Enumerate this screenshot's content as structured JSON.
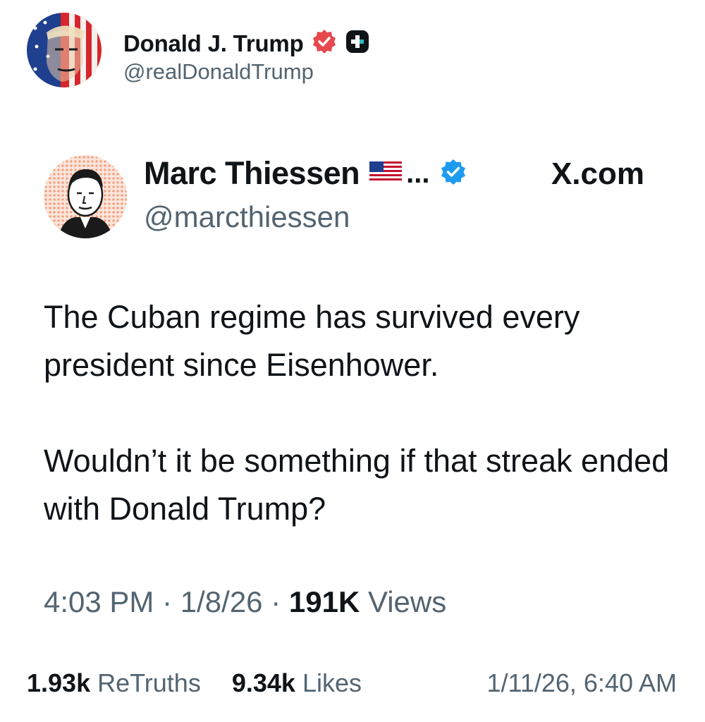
{
  "truth": {
    "author_name": "Donald J. Trump",
    "author_handle": "@realDonaldTrump",
    "verified_badge_color": "#e5484d"
  },
  "embed": {
    "author_name": "Marc Thiessen",
    "name_ellipsis": "...",
    "author_handle": "@marcthiessen",
    "source": "X.com",
    "verified_color": "#1d9bf0",
    "body": [
      "The Cuban regime has survived every president since Eisenhower.",
      "Wouldn’t it be something if that streak ended with Donald Trump?"
    ],
    "time": "4:03 PM",
    "date": "1/8/26",
    "views_count": "191K",
    "views_label": "Views",
    "separator": "·"
  },
  "stats": {
    "retruths_count": "1.93k",
    "retruths_label": "ReTruths",
    "likes_count": "9.34k",
    "likes_label": "Likes",
    "posted_at": "1/11/26, 6:40 AM"
  }
}
